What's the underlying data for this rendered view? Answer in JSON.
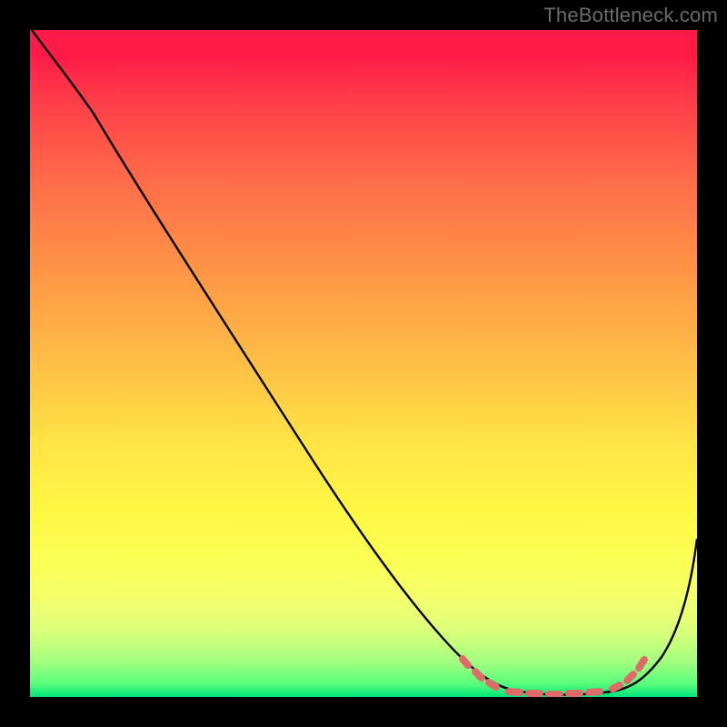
{
  "watermark": "TheBottleneck.com",
  "chart_data": {
    "type": "line",
    "title": "",
    "xlabel": "",
    "ylabel": "",
    "xlim": [
      0,
      100
    ],
    "ylim": [
      0,
      100
    ],
    "series": [
      {
        "name": "bottleneck-curve",
        "x": [
          0,
          6,
          15,
          30,
          45,
          58,
          65,
          70,
          75,
          80,
          85,
          90,
          100
        ],
        "y": [
          100,
          95,
          85,
          63,
          40,
          20,
          10,
          3,
          0,
          0,
          0,
          5,
          30
        ]
      }
    ],
    "optimal_zone": {
      "x_start": 66,
      "x_end": 91,
      "marker_color": "#e06a6a"
    },
    "gradient_stops": [
      {
        "offset": 0,
        "color": "#ff1b47"
      },
      {
        "offset": 50,
        "color": "#ffbf45"
      },
      {
        "offset": 80,
        "color": "#fbff55"
      },
      {
        "offset": 100,
        "color": "#00e37a"
      }
    ]
  }
}
